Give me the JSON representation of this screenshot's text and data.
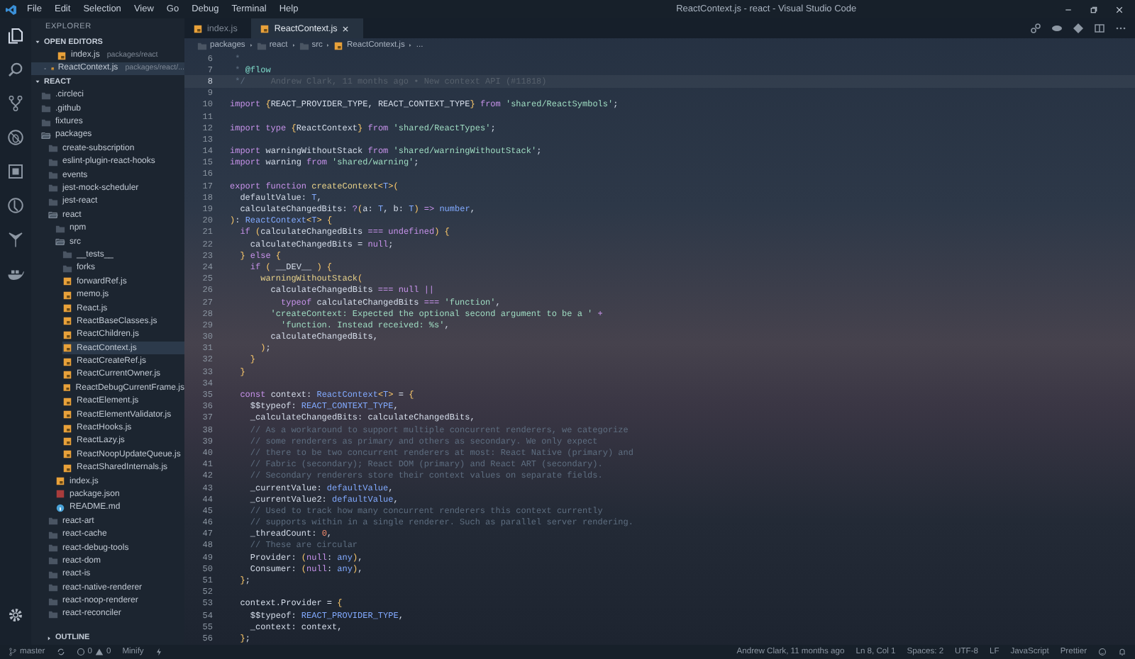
{
  "window": {
    "title": "ReactContext.js - react - Visual Studio Code"
  },
  "menu": [
    "File",
    "Edit",
    "Selection",
    "View",
    "Go",
    "Debug",
    "Terminal",
    "Help"
  ],
  "sidebar": {
    "title": "EXPLORER",
    "open_editors": {
      "title": "OPEN EDITORS",
      "expanded": true,
      "items": [
        {
          "name": "index.js",
          "path": "packages/react",
          "kind": "js",
          "selected": false
        },
        {
          "name": "ReactContext.js",
          "path": "packages/react/...",
          "kind": "js",
          "selected": true
        }
      ]
    },
    "project": {
      "title": "REACT",
      "expanded": true
    },
    "tree": [
      {
        "name": ".circleci",
        "kind": "folder",
        "expanded": false,
        "selected": false
      },
      {
        "name": ".github",
        "kind": "folder",
        "expanded": false,
        "selected": false
      },
      {
        "name": "fixtures",
        "kind": "folder",
        "expanded": false,
        "selected": false
      },
      {
        "name": "packages",
        "kind": "folder",
        "expanded": true,
        "selected": false,
        "children": [
          {
            "name": "create-subscription",
            "kind": "folder",
            "expanded": false,
            "selected": false
          },
          {
            "name": "eslint-plugin-react-hooks",
            "kind": "folder",
            "expanded": false,
            "selected": false
          },
          {
            "name": "events",
            "kind": "folder",
            "expanded": false,
            "selected": false
          },
          {
            "name": "jest-mock-scheduler",
            "kind": "folder",
            "expanded": false,
            "selected": false
          },
          {
            "name": "jest-react",
            "kind": "folder",
            "expanded": false,
            "selected": false
          },
          {
            "name": "react",
            "kind": "folder",
            "expanded": true,
            "selected": false,
            "children": [
              {
                "name": "npm",
                "kind": "folder",
                "expanded": false,
                "selected": false
              },
              {
                "name": "src",
                "kind": "folder",
                "expanded": true,
                "selected": false,
                "children": [
                  {
                    "name": "__tests__",
                    "kind": "folder",
                    "expanded": false,
                    "selected": false
                  },
                  {
                    "name": "forks",
                    "kind": "folder",
                    "expanded": false,
                    "selected": false
                  },
                  {
                    "name": "forwardRef.js",
                    "kind": "js",
                    "selected": false
                  },
                  {
                    "name": "memo.js",
                    "kind": "js",
                    "selected": false
                  },
                  {
                    "name": "React.js",
                    "kind": "js",
                    "selected": false
                  },
                  {
                    "name": "ReactBaseClasses.js",
                    "kind": "js",
                    "selected": false
                  },
                  {
                    "name": "ReactChildren.js",
                    "kind": "js",
                    "selected": false
                  },
                  {
                    "name": "ReactContext.js",
                    "kind": "js",
                    "selected": true
                  },
                  {
                    "name": "ReactCreateRef.js",
                    "kind": "js",
                    "selected": false
                  },
                  {
                    "name": "ReactCurrentOwner.js",
                    "kind": "js",
                    "selected": false
                  },
                  {
                    "name": "ReactDebugCurrentFrame.js",
                    "kind": "js",
                    "selected": false
                  },
                  {
                    "name": "ReactElement.js",
                    "kind": "js",
                    "selected": false
                  },
                  {
                    "name": "ReactElementValidator.js",
                    "kind": "js",
                    "selected": false
                  },
                  {
                    "name": "ReactHooks.js",
                    "kind": "js",
                    "selected": false
                  },
                  {
                    "name": "ReactLazy.js",
                    "kind": "js",
                    "selected": false
                  },
                  {
                    "name": "ReactNoopUpdateQueue.js",
                    "kind": "js",
                    "selected": false
                  },
                  {
                    "name": "ReactSharedInternals.js",
                    "kind": "js",
                    "selected": false
                  }
                ]
              },
              {
                "name": "index.js",
                "kind": "js",
                "selected": false
              },
              {
                "name": "package.json",
                "kind": "json",
                "selected": false
              },
              {
                "name": "README.md",
                "kind": "md",
                "selected": false
              }
            ]
          },
          {
            "name": "react-art",
            "kind": "folder",
            "expanded": false,
            "selected": false
          },
          {
            "name": "react-cache",
            "kind": "folder",
            "expanded": false,
            "selected": false
          },
          {
            "name": "react-debug-tools",
            "kind": "folder",
            "expanded": false,
            "selected": false
          },
          {
            "name": "react-dom",
            "kind": "folder",
            "expanded": false,
            "selected": false
          },
          {
            "name": "react-is",
            "kind": "folder",
            "expanded": false,
            "selected": false
          },
          {
            "name": "react-native-renderer",
            "kind": "folder",
            "expanded": false,
            "selected": false
          },
          {
            "name": "react-noop-renderer",
            "kind": "folder",
            "expanded": false,
            "selected": false
          },
          {
            "name": "react-reconciler",
            "kind": "folder",
            "expanded": false,
            "selected": false
          }
        ]
      }
    ],
    "outline": {
      "title": "OUTLINE",
      "expanded": false
    }
  },
  "tabs": [
    {
      "label": "index.js",
      "selected": false
    },
    {
      "label": "ReactContext.js",
      "selected": true
    }
  ],
  "breadcrumbs": [
    {
      "text": "packages",
      "kind": "folder"
    },
    {
      "text": "react",
      "kind": "folder"
    },
    {
      "text": "src",
      "kind": "folder"
    },
    {
      "text": "ReactContext.js",
      "kind": "js"
    },
    {
      "text": "...",
      "kind": "symbol"
    }
  ],
  "editor": {
    "lines": [
      {
        "number": "6",
        "current": false,
        "tokens": [
          {
            "kind": "comment",
            "text": " *"
          }
        ]
      },
      {
        "number": "7",
        "current": false,
        "tokens": [
          {
            "kind": "comment",
            "text": " * "
          },
          {
            "kind": "tag",
            "text": "@flow"
          }
        ]
      },
      {
        "number": "8",
        "current": true,
        "tokens": [
          {
            "kind": "comment",
            "text": " */"
          }
        ],
        "blame": "Andrew Clark, 11 months ago • New context API (#11818)"
      },
      {
        "number": "9",
        "current": false
      },
      {
        "number": "10",
        "current": false,
        "tokens": [
          {
            "kind": "kw",
            "text": "import "
          },
          {
            "kind": "punc",
            "text": "{"
          },
          {
            "kind": "plain",
            "text": "REACT_PROVIDER_TYPE, REACT_CONTEXT_TYPE"
          },
          {
            "kind": "punc",
            "text": "}"
          },
          {
            "kind": "kw",
            "text": " from "
          },
          {
            "kind": "str",
            "text": "'shared/ReactSymbols'"
          },
          {
            "kind": "plain",
            "text": ";"
          }
        ]
      },
      {
        "number": "11",
        "current": false
      },
      {
        "number": "12",
        "current": false,
        "tokens": [
          {
            "kind": "kw",
            "text": "import type "
          },
          {
            "kind": "punc",
            "text": "{"
          },
          {
            "kind": "plain",
            "text": "ReactContext"
          },
          {
            "kind": "punc",
            "text": "}"
          },
          {
            "kind": "kw",
            "text": " from "
          },
          {
            "kind": "str",
            "text": "'shared/ReactTypes'"
          },
          {
            "kind": "plain",
            "text": ";"
          }
        ]
      },
      {
        "number": "13",
        "current": false
      },
      {
        "number": "14",
        "current": false,
        "tokens": [
          {
            "kind": "kw",
            "text": "import "
          },
          {
            "kind": "plain",
            "text": "warningWithoutStack"
          },
          {
            "kind": "kw",
            "text": " from "
          },
          {
            "kind": "str",
            "text": "'shared/warningWithoutStack'"
          },
          {
            "kind": "plain",
            "text": ";"
          }
        ]
      },
      {
        "number": "15",
        "current": false,
        "tokens": [
          {
            "kind": "kw",
            "text": "import "
          },
          {
            "kind": "plain",
            "text": "warning"
          },
          {
            "kind": "kw",
            "text": " from "
          },
          {
            "kind": "str",
            "text": "'shared/warning'"
          },
          {
            "kind": "plain",
            "text": ";"
          }
        ]
      },
      {
        "number": "16",
        "current": false
      },
      {
        "number": "17",
        "current": false,
        "tokens": [
          {
            "kind": "kw",
            "text": "export function "
          },
          {
            "kind": "fn",
            "text": "createContext"
          },
          {
            "kind": "punc",
            "text": "<"
          },
          {
            "kind": "type",
            "text": "T"
          },
          {
            "kind": "punc",
            "text": ">("
          }
        ]
      },
      {
        "number": "18",
        "current": false,
        "tokens": [
          {
            "kind": "plain",
            "text": "  defaultValue: "
          },
          {
            "kind": "type",
            "text": "T"
          },
          {
            "kind": "plain",
            "text": ","
          }
        ]
      },
      {
        "number": "19",
        "current": false,
        "tokens": [
          {
            "kind": "plain",
            "text": "  calculateChangedBits: "
          },
          {
            "kind": "kw",
            "text": "?"
          },
          {
            "kind": "punc",
            "text": "("
          },
          {
            "kind": "plain",
            "text": "a: "
          },
          {
            "kind": "type",
            "text": "T"
          },
          {
            "kind": "plain",
            "text": ", b: "
          },
          {
            "kind": "type",
            "text": "T"
          },
          {
            "kind": "punc",
            "text": ")"
          },
          {
            "kind": "kw",
            "text": " => "
          },
          {
            "kind": "type",
            "text": "number"
          },
          {
            "kind": "plain",
            "text": ","
          }
        ]
      },
      {
        "number": "20",
        "current": false,
        "tokens": [
          {
            "kind": "punc",
            "text": ")"
          },
          {
            "kind": "plain",
            "text": ": "
          },
          {
            "kind": "type",
            "text": "ReactContext"
          },
          {
            "kind": "punc",
            "text": "<"
          },
          {
            "kind": "type",
            "text": "T"
          },
          {
            "kind": "punc",
            "text": "> {"
          }
        ]
      },
      {
        "number": "21",
        "current": false,
        "tokens": [
          {
            "kind": "kw",
            "text": "  if "
          },
          {
            "kind": "punc",
            "text": "("
          },
          {
            "kind": "plain",
            "text": "calculateChangedBits "
          },
          {
            "kind": "kw",
            "text": "=== undefined"
          },
          {
            "kind": "punc",
            "text": ") {"
          }
        ]
      },
      {
        "number": "22",
        "current": false,
        "tokens": [
          {
            "kind": "plain",
            "text": "    calculateChangedBits = "
          },
          {
            "kind": "kw",
            "text": "null"
          },
          {
            "kind": "plain",
            "text": ";"
          }
        ]
      },
      {
        "number": "23",
        "current": false,
        "tokens": [
          {
            "kind": "punc",
            "text": "  } "
          },
          {
            "kind": "kw",
            "text": "else "
          },
          {
            "kind": "punc",
            "text": "{"
          }
        ]
      },
      {
        "number": "24",
        "current": false,
        "tokens": [
          {
            "kind": "kw",
            "text": "    if "
          },
          {
            "kind": "punc",
            "text": "("
          },
          {
            "kind": "plain",
            "text": " __DEV__ "
          },
          {
            "kind": "punc",
            "text": ") {"
          }
        ]
      },
      {
        "number": "25",
        "current": false,
        "tokens": [
          {
            "kind": "fn",
            "text": "      warningWithoutStack"
          },
          {
            "kind": "punc",
            "text": "("
          }
        ]
      },
      {
        "number": "26",
        "current": false,
        "tokens": [
          {
            "kind": "plain",
            "text": "        calculateChangedBits "
          },
          {
            "kind": "kw",
            "text": "=== null ||"
          }
        ]
      },
      {
        "number": "27",
        "current": false,
        "tokens": [
          {
            "kind": "kw",
            "text": "          typeof "
          },
          {
            "kind": "plain",
            "text": "calculateChangedBits "
          },
          {
            "kind": "kw",
            "text": "=== "
          },
          {
            "kind": "str",
            "text": "'function'"
          },
          {
            "kind": "plain",
            "text": ","
          }
        ]
      },
      {
        "number": "28",
        "current": false,
        "tokens": [
          {
            "kind": "str",
            "text": "        'createContext: Expected the optional second argument to be a '"
          },
          {
            "kind": "kw",
            "text": " +"
          }
        ]
      },
      {
        "number": "29",
        "current": false,
        "tokens": [
          {
            "kind": "str",
            "text": "          'function. Instead received: %s'"
          },
          {
            "kind": "plain",
            "text": ","
          }
        ]
      },
      {
        "number": "30",
        "current": false,
        "tokens": [
          {
            "kind": "plain",
            "text": "        calculateChangedBits,"
          }
        ]
      },
      {
        "number": "31",
        "current": false,
        "tokens": [
          {
            "kind": "punc",
            "text": "      )"
          },
          {
            "kind": "plain",
            "text": ";"
          }
        ]
      },
      {
        "number": "32",
        "current": false,
        "tokens": [
          {
            "kind": "punc",
            "text": "    }"
          }
        ]
      },
      {
        "number": "33",
        "current": false,
        "tokens": [
          {
            "kind": "punc",
            "text": "  }"
          }
        ]
      },
      {
        "number": "34",
        "current": false
      },
      {
        "number": "35",
        "current": false,
        "tokens": [
          {
            "kind": "kw",
            "text": "  const "
          },
          {
            "kind": "plain",
            "text": "context: "
          },
          {
            "kind": "type",
            "text": "ReactContext"
          },
          {
            "kind": "punc",
            "text": "<"
          },
          {
            "kind": "type",
            "text": "T"
          },
          {
            "kind": "punc",
            "text": ">"
          },
          {
            "kind": "plain",
            "text": " = "
          },
          {
            "kind": "punc",
            "text": "{"
          }
        ]
      },
      {
        "number": "36",
        "current": false,
        "tokens": [
          {
            "kind": "plain",
            "text": "    $$typeof: "
          },
          {
            "kind": "type",
            "text": "REACT_CONTEXT_TYPE"
          },
          {
            "kind": "plain",
            "text": ","
          }
        ]
      },
      {
        "number": "37",
        "current": false,
        "tokens": [
          {
            "kind": "plain",
            "text": "    _calculateChangedBits: calculateChangedBits,"
          }
        ]
      },
      {
        "number": "38",
        "current": false,
        "tokens": [
          {
            "kind": "comment",
            "text": "    // As a workaround to support multiple concurrent renderers, we categorize"
          }
        ]
      },
      {
        "number": "39",
        "current": false,
        "tokens": [
          {
            "kind": "comment",
            "text": "    // some renderers as primary and others as secondary. We only expect"
          }
        ]
      },
      {
        "number": "40",
        "current": false,
        "tokens": [
          {
            "kind": "comment",
            "text": "    // there to be two concurrent renderers at most: React Native (primary) and"
          }
        ]
      },
      {
        "number": "41",
        "current": false,
        "tokens": [
          {
            "kind": "comment",
            "text": "    // Fabric (secondary); React DOM (primary) and React ART (secondary)."
          }
        ]
      },
      {
        "number": "42",
        "current": false,
        "tokens": [
          {
            "kind": "comment",
            "text": "    // Secondary renderers store their context values on separate fields."
          }
        ]
      },
      {
        "number": "43",
        "current": false,
        "tokens": [
          {
            "kind": "plain",
            "text": "    _currentValue: "
          },
          {
            "kind": "type",
            "text": "defaultValue"
          },
          {
            "kind": "plain",
            "text": ","
          }
        ]
      },
      {
        "number": "44",
        "current": false,
        "tokens": [
          {
            "kind": "plain",
            "text": "    _currentValue2: "
          },
          {
            "kind": "type",
            "text": "defaultValue"
          },
          {
            "kind": "plain",
            "text": ","
          }
        ]
      },
      {
        "number": "45",
        "current": false,
        "tokens": [
          {
            "kind": "comment",
            "text": "    // Used to track how many concurrent renderers this context currently"
          }
        ]
      },
      {
        "number": "46",
        "current": false,
        "tokens": [
          {
            "kind": "comment",
            "text": "    // supports within in a single renderer. Such as parallel server rendering."
          }
        ]
      },
      {
        "number": "47",
        "current": false,
        "tokens": [
          {
            "kind": "plain",
            "text": "    _threadCount: "
          },
          {
            "kind": "num",
            "text": "0"
          },
          {
            "kind": "plain",
            "text": ","
          }
        ]
      },
      {
        "number": "48",
        "current": false,
        "tokens": [
          {
            "kind": "comment",
            "text": "    // These are circular"
          }
        ]
      },
      {
        "number": "49",
        "current": false,
        "tokens": [
          {
            "kind": "plain",
            "text": "    Provider: "
          },
          {
            "kind": "punc",
            "text": "("
          },
          {
            "kind": "kw",
            "text": "null"
          },
          {
            "kind": "plain",
            "text": ": "
          },
          {
            "kind": "type",
            "text": "any"
          },
          {
            "kind": "punc",
            "text": ")"
          },
          {
            "kind": "plain",
            "text": ","
          }
        ]
      },
      {
        "number": "50",
        "current": false,
        "tokens": [
          {
            "kind": "plain",
            "text": "    Consumer: "
          },
          {
            "kind": "punc",
            "text": "("
          },
          {
            "kind": "kw",
            "text": "null"
          },
          {
            "kind": "plain",
            "text": ": "
          },
          {
            "kind": "type",
            "text": "any"
          },
          {
            "kind": "punc",
            "text": ")"
          },
          {
            "kind": "plain",
            "text": ","
          }
        ]
      },
      {
        "number": "51",
        "current": false,
        "tokens": [
          {
            "kind": "punc",
            "text": "  }"
          },
          {
            "kind": "plain",
            "text": ";"
          }
        ]
      },
      {
        "number": "52",
        "current": false
      },
      {
        "number": "53",
        "current": false,
        "tokens": [
          {
            "kind": "plain",
            "text": "  context.Provider = "
          },
          {
            "kind": "punc",
            "text": "{"
          }
        ]
      },
      {
        "number": "54",
        "current": false,
        "tokens": [
          {
            "kind": "plain",
            "text": "    $$typeof: "
          },
          {
            "kind": "type",
            "text": "REACT_PROVIDER_TYPE"
          },
          {
            "kind": "plain",
            "text": ","
          }
        ]
      },
      {
        "number": "55",
        "current": false,
        "tokens": [
          {
            "kind": "plain",
            "text": "    _context: context,"
          }
        ]
      },
      {
        "number": "56",
        "current": false,
        "tokens": [
          {
            "kind": "punc",
            "text": "  }"
          },
          {
            "kind": "plain",
            "text": ";"
          }
        ]
      }
    ]
  },
  "status_bar": {
    "branch": "master",
    "errors": "0",
    "warnings": "0",
    "left_items": [
      "Minify"
    ],
    "right_items": [
      "Andrew Clark, 11 months ago",
      "Ln 8, Col 1",
      "Spaces: 2",
      "UTF-8",
      "LF",
      "JavaScript",
      "Prettier"
    ]
  }
}
